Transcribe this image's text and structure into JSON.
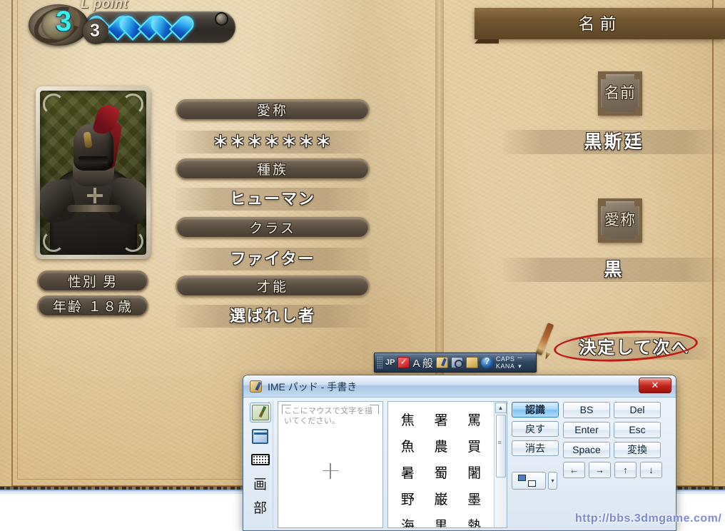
{
  "game": {
    "hud": {
      "label": "L point",
      "level_value": "3",
      "secondary_value": "3",
      "hearts": 3
    },
    "portrait": {
      "alt": "armored-knight-portrait"
    },
    "left_plaques": [
      {
        "name": "gender",
        "text": "性別 男"
      },
      {
        "name": "age",
        "text": "年齢 １８歳"
      }
    ],
    "left_fields": [
      {
        "label": "愛称",
        "value": "＊＊＊＊＊＊＊"
      },
      {
        "label": "種族",
        "value": "ヒューマン"
      },
      {
        "label": "クラス",
        "value": "ファイター"
      },
      {
        "label": "才能",
        "value": "選ばれし者"
      }
    ],
    "right_page": {
      "banner_title": "名前",
      "fields": [
        {
          "label": "名前",
          "value": "黒斯廷"
        },
        {
          "label": "愛称",
          "value": "黒"
        }
      ],
      "next_button": "決定して次へ"
    }
  },
  "langbar": {
    "lang": "JP",
    "mode": "A 般",
    "caps": "CAPS",
    "kana": "KANA",
    "minimize": "–",
    "chevron": "▾"
  },
  "ime_pad": {
    "title": "IME パッド - 手書き",
    "close_label": "✕",
    "sidebar": [
      {
        "name": "handwriting",
        "glyph": ""
      },
      {
        "name": "softkeyboard",
        "glyph": ""
      },
      {
        "name": "keyboard",
        "glyph": ""
      },
      {
        "name": "stroke-count",
        "glyph": "画"
      },
      {
        "name": "radical",
        "glyph": "部"
      }
    ],
    "canvas_placeholder": "ここにマウスで文字を描いてください。",
    "candidates": [
      "焦",
      "署",
      "罵",
      "魚",
      "農",
      "買",
      "暑",
      "蜀",
      "闍",
      "野",
      "巌",
      "墨",
      "海",
      "黒",
      "熱"
    ],
    "scroll_up": "▲",
    "actions": [
      {
        "label": "認識",
        "primary": true
      },
      {
        "label": "戻す",
        "primary": false
      },
      {
        "label": "消去",
        "primary": false
      }
    ],
    "ime_selector_arrow": "▾",
    "keys": [
      {
        "label": "BS",
        "arrow": false
      },
      {
        "label": "Del",
        "arrow": false
      },
      {
        "label": "Enter",
        "arrow": false
      },
      {
        "label": "Esc",
        "arrow": false
      },
      {
        "label": "Space",
        "arrow": false
      },
      {
        "label": "変換",
        "arrow": false
      },
      {
        "label": "←",
        "arrow": true
      },
      {
        "label": "→",
        "arrow": true
      },
      {
        "label": "↑",
        "arrow": true
      },
      {
        "label": "↓",
        "arrow": true
      }
    ]
  },
  "watermark": "http://bbs.3dmgame.com/",
  "colors": {
    "parchment": "#e3cb9d",
    "plaque": "#5c5043",
    "annotation_red": "#c01a18",
    "heart_blue": "#35b5f0",
    "lpoint_cyan": "#39f0ea"
  }
}
